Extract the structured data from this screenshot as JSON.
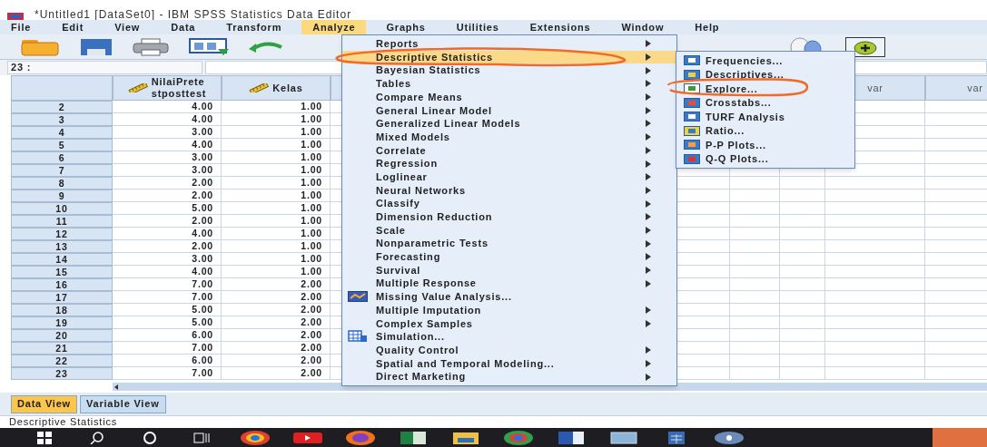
{
  "window": {
    "title": "*Untitled1 [DataSet0] - IBM SPSS Statistics Data Editor"
  },
  "menu_bar": [
    {
      "label": "File",
      "selected": false
    },
    {
      "label": "Edit",
      "selected": false
    },
    {
      "label": "View",
      "selected": false
    },
    {
      "label": "Data",
      "selected": false
    },
    {
      "label": "Transform",
      "selected": false
    },
    {
      "label": "Analyze",
      "selected": true
    },
    {
      "label": "Graphs",
      "selected": false
    },
    {
      "label": "Utilities",
      "selected": false
    },
    {
      "label": "Extensions",
      "selected": false
    },
    {
      "label": "Window",
      "selected": false
    },
    {
      "label": "Help",
      "selected": false
    }
  ],
  "cell_reference": "23 :",
  "columns": [
    {
      "lines": [
        "NilaiPrete",
        "stposttest"
      ]
    },
    {
      "lines": [
        "Kelas"
      ]
    }
  ],
  "var_columns": [
    "var",
    "var"
  ],
  "rows": [
    {
      "n": "2",
      "cells": [
        "4.00",
        "1.00"
      ]
    },
    {
      "n": "3",
      "cells": [
        "4.00",
        "1.00"
      ]
    },
    {
      "n": "4",
      "cells": [
        "3.00",
        "1.00"
      ]
    },
    {
      "n": "5",
      "cells": [
        "4.00",
        "1.00"
      ]
    },
    {
      "n": "6",
      "cells": [
        "3.00",
        "1.00"
      ]
    },
    {
      "n": "7",
      "cells": [
        "3.00",
        "1.00"
      ]
    },
    {
      "n": "8",
      "cells": [
        "2.00",
        "1.00"
      ]
    },
    {
      "n": "9",
      "cells": [
        "2.00",
        "1.00"
      ]
    },
    {
      "n": "10",
      "cells": [
        "5.00",
        "1.00"
      ]
    },
    {
      "n": "11",
      "cells": [
        "2.00",
        "1.00"
      ]
    },
    {
      "n": "12",
      "cells": [
        "4.00",
        "1.00"
      ]
    },
    {
      "n": "13",
      "cells": [
        "2.00",
        "1.00"
      ]
    },
    {
      "n": "14",
      "cells": [
        "3.00",
        "1.00"
      ]
    },
    {
      "n": "15",
      "cells": [
        "4.00",
        "1.00"
      ]
    },
    {
      "n": "16",
      "cells": [
        "7.00",
        "2.00"
      ]
    },
    {
      "n": "17",
      "cells": [
        "7.00",
        "2.00"
      ]
    },
    {
      "n": "18",
      "cells": [
        "5.00",
        "2.00"
      ]
    },
    {
      "n": "19",
      "cells": [
        "5.00",
        "2.00"
      ]
    },
    {
      "n": "20",
      "cells": [
        "6.00",
        "2.00"
      ]
    },
    {
      "n": "21",
      "cells": [
        "7.00",
        "2.00"
      ]
    },
    {
      "n": "22",
      "cells": [
        "6.00",
        "2.00"
      ]
    },
    {
      "n": "23",
      "cells": [
        "7.00",
        "2.00"
      ]
    }
  ],
  "analyze_menu": [
    {
      "label": "Reports",
      "kind": "plain",
      "submenu": true,
      "selected": false
    },
    {
      "label": "Descriptive Statistics",
      "kind": "plain",
      "submenu": true,
      "selected": true
    },
    {
      "label": "Bayesian Statistics",
      "kind": "plain",
      "submenu": true,
      "selected": false
    },
    {
      "label": "Tables",
      "kind": "plain",
      "submenu": true,
      "selected": false
    },
    {
      "label": "Compare Means",
      "kind": "plain",
      "submenu": true,
      "selected": false
    },
    {
      "label": "General Linear Model",
      "kind": "plain",
      "submenu": true,
      "selected": false
    },
    {
      "label": "Generalized Linear Models",
      "kind": "plain",
      "submenu": true,
      "selected": false
    },
    {
      "label": "Mixed Models",
      "kind": "plain",
      "submenu": true,
      "selected": false
    },
    {
      "label": "Correlate",
      "kind": "plain",
      "submenu": true,
      "selected": false
    },
    {
      "label": "Regression",
      "kind": "plain",
      "submenu": true,
      "selected": false
    },
    {
      "label": "Loglinear",
      "kind": "plain",
      "submenu": true,
      "selected": false
    },
    {
      "label": "Neural Networks",
      "kind": "plain",
      "submenu": true,
      "selected": false
    },
    {
      "label": "Classify",
      "kind": "plain",
      "submenu": true,
      "selected": false
    },
    {
      "label": "Dimension Reduction",
      "kind": "plain",
      "submenu": true,
      "selected": false
    },
    {
      "label": "Scale",
      "kind": "plain",
      "submenu": true,
      "selected": false
    },
    {
      "label": "Nonparametric Tests",
      "kind": "plain",
      "submenu": true,
      "selected": false
    },
    {
      "label": "Forecasting",
      "kind": "plain",
      "submenu": true,
      "selected": false
    },
    {
      "label": "Survival",
      "kind": "plain",
      "submenu": true,
      "selected": false
    },
    {
      "label": "Multiple Response",
      "kind": "plain",
      "submenu": true,
      "selected": false
    },
    {
      "label": "Missing Value Analysis...",
      "kind": "missing_values",
      "submenu": false,
      "selected": false
    },
    {
      "label": "Multiple Imputation",
      "kind": "plain",
      "submenu": true,
      "selected": false
    },
    {
      "label": "Complex Samples",
      "kind": "plain",
      "submenu": true,
      "selected": false
    },
    {
      "label": "Simulation...",
      "kind": "simulation",
      "submenu": false,
      "selected": false
    },
    {
      "label": "Quality Control",
      "kind": "plain",
      "submenu": true,
      "selected": false
    },
    {
      "label": "Spatial and Temporal Modeling...",
      "kind": "plain",
      "submenu": true,
      "selected": false
    },
    {
      "label": "Direct Marketing",
      "kind": "plain",
      "submenu": true,
      "selected": false
    }
  ],
  "descriptive_submenu": [
    {
      "label": "Frequencies...",
      "kind": "frequencies",
      "selected": false
    },
    {
      "label": "Descriptives...",
      "kind": "descriptives",
      "selected": false
    },
    {
      "label": "Explore...",
      "kind": "explore",
      "selected": false
    },
    {
      "label": "Crosstabs...",
      "kind": "crosstabs",
      "selected": false
    },
    {
      "label": "TURF Analysis",
      "kind": "turf",
      "selected": false
    },
    {
      "label": "Ratio...",
      "kind": "ratio",
      "selected": false
    },
    {
      "label": "P-P Plots...",
      "kind": "pp",
      "selected": false
    },
    {
      "label": "Q-Q Plots...",
      "kind": "qq",
      "selected": false
    }
  ],
  "view_tabs": [
    {
      "label": "Data View",
      "selected": true
    },
    {
      "label": "Variable View",
      "selected": false
    }
  ],
  "status_bar": "Descriptive Statistics"
}
